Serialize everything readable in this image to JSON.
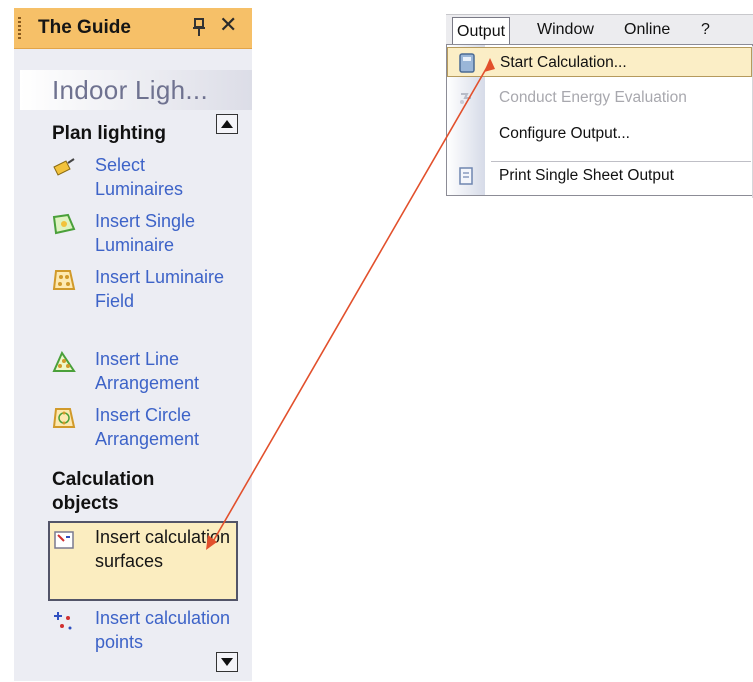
{
  "guide": {
    "title": "The Guide",
    "section_title": "Indoor Ligh...",
    "groups": [
      {
        "title": "Plan lighting",
        "tasks": [
          {
            "label": "Select Luminaires",
            "icon": "luminaire-select-icon"
          },
          {
            "label": "Insert Single Luminaire",
            "icon": "single-luminaire-icon"
          },
          {
            "label": "Insert Luminaire Field",
            "icon": "luminaire-field-icon"
          },
          {
            "label": "Insert Line Arrangement",
            "icon": "line-arrangement-icon"
          },
          {
            "label": "Insert Circle Arrangement",
            "icon": "circle-arrangement-icon"
          }
        ]
      },
      {
        "title": "Calculation objects",
        "tasks": [
          {
            "label": "Insert calculation surfaces",
            "icon": "calculation-surface-icon",
            "selected": true
          },
          {
            "label": "Insert calculation points",
            "icon": "calculation-points-icon"
          }
        ]
      }
    ]
  },
  "menubar": {
    "items": [
      "Output",
      "Window",
      "Online",
      "?"
    ],
    "active": "Output"
  },
  "output_menu": {
    "items": [
      {
        "label": "Start Calculation...",
        "icon": "calculator-icon",
        "highlighted": true
      },
      {
        "label": "Conduct Energy Evaluation",
        "icon": "energy-icon",
        "disabled": true
      },
      {
        "label": "Configure Output...",
        "icon": ""
      },
      {
        "label": "Print Single Sheet Output",
        "icon": "print-sheet-icon"
      }
    ]
  },
  "colors": {
    "titlebar": "#f6c068",
    "panel": "#ecedf3",
    "link": "#3d63c8",
    "selected": "#fbedc0",
    "arrow": "#e2502c"
  }
}
